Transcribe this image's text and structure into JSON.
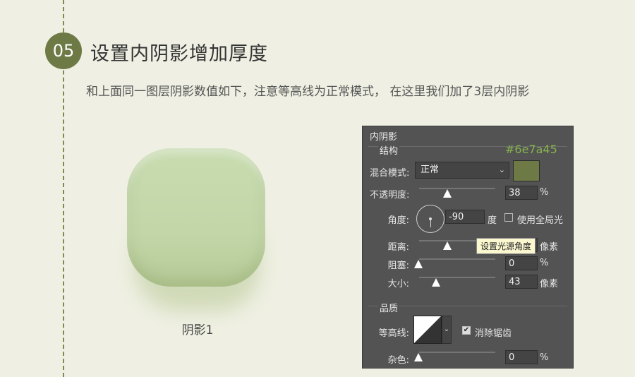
{
  "step": {
    "number": "05",
    "title": "设置内阴影增加厚度"
  },
  "description": "和上面同一图层阴影数值如下，注意等高线为正常模式， 在这里我们加了3层内阴影",
  "preview": {
    "label": "阴影1",
    "fill_color": "#c6d9ad"
  },
  "panel": {
    "title": "内阴影",
    "structure": {
      "title": "结构",
      "hex_color_label": "#6e7a45",
      "color": "#6e7a45",
      "blend_mode": {
        "label": "混合模式:",
        "value": "正常"
      },
      "opacity": {
        "label": "不透明度:",
        "value": "38",
        "unit": "%",
        "slider": 0.38
      },
      "angle": {
        "label": "角度:",
        "value": "-90",
        "unit": "度",
        "global_light_label": "使用全局光",
        "global_light_checked": false
      },
      "distance": {
        "label": "距离:",
        "unit": "像素",
        "slider": 0.38
      },
      "tooltip": "设置光源角度",
      "choke": {
        "label": "阻塞:",
        "value": "0",
        "unit": "%",
        "slider": 0
      },
      "size": {
        "label": "大小:",
        "value": "43",
        "unit": "像素",
        "slider": 0.18
      }
    },
    "quality": {
      "title": "品质",
      "contour": {
        "label": "等高线:",
        "anti_alias_label": "消除锯齿",
        "anti_alias_checked": true
      },
      "noise": {
        "label": "杂色:",
        "value": "0",
        "unit": "%",
        "slider": 0
      }
    }
  }
}
